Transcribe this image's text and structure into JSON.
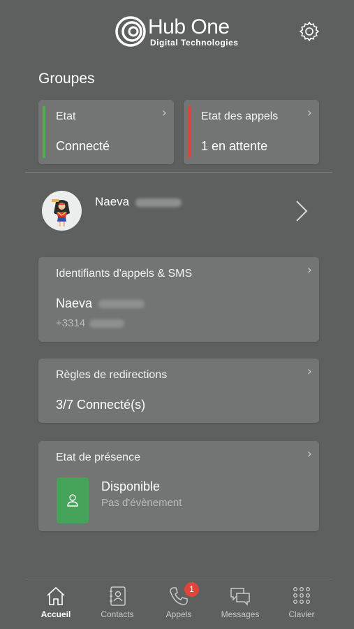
{
  "header": {
    "brand": "Hub One",
    "brand_sub": "Digital Technologies",
    "settings_icon": "gear-icon"
  },
  "groups": {
    "title": "Groupes",
    "status_card": {
      "label": "Etat",
      "value": "Connecté",
      "accent": "#4caf50"
    },
    "calls_card": {
      "label": "Etat des appels",
      "value": "1 en attente",
      "accent": "#e0453c"
    }
  },
  "profile": {
    "first_name": "Naeva"
  },
  "caller_id": {
    "label": "Identifiants d'appels & SMS",
    "name": "Naeva",
    "number_prefix": "+3314"
  },
  "redirects": {
    "label": "Règles de redirections",
    "value": "3/7 Connecté(s)"
  },
  "presence": {
    "label": "Etat de présence",
    "status": "Disponible",
    "event": "Pas d'évènement",
    "color": "#46a35a"
  },
  "nav": {
    "items": [
      {
        "label": "Accueil",
        "icon": "home-icon"
      },
      {
        "label": "Contacts",
        "icon": "contacts-icon"
      },
      {
        "label": "Appels",
        "icon": "phone-icon"
      },
      {
        "label": "Messages",
        "icon": "messages-icon"
      },
      {
        "label": "Clavier",
        "icon": "keypad-icon"
      }
    ],
    "calls_badge": "1"
  }
}
